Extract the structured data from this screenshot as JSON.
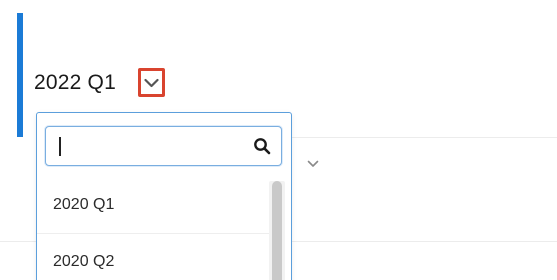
{
  "header": {
    "period_title": "2022 Q1"
  },
  "dropdown": {
    "search": {
      "value": "",
      "placeholder": ""
    },
    "options": [
      {
        "label": "2020 Q1"
      },
      {
        "label": "2020 Q2"
      }
    ]
  },
  "icons": {
    "toggle": "chevron-down-icon",
    "search": "search-icon",
    "background_toggle": "chevron-down-icon"
  },
  "colors": {
    "accent": "#1b7bd6",
    "highlight_border": "#d9442f",
    "dropdown_border": "#5c9fdc"
  }
}
